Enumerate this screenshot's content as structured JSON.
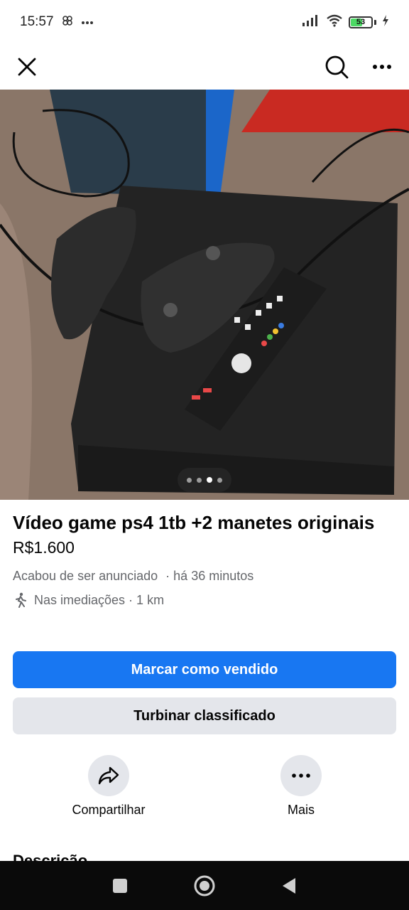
{
  "status_bar": {
    "time": "15:57",
    "battery": "53"
  },
  "listing": {
    "title": "Vídeo game ps4 1tb +2 manetes originais",
    "price": "R$1.600",
    "listed": "Acabou de ser anunciado",
    "listed_time": "· há 36 minutos",
    "location": "Nas imediações · 1 km",
    "photo_count": 4,
    "photo_index": 3
  },
  "buttons": {
    "mark_sold": "Marcar como vendido",
    "boost": "Turbinar classificado"
  },
  "actions": {
    "share": "Compartilhar",
    "more": "Mais"
  },
  "section_peek": "Descrição",
  "icons": [
    "close-icon",
    "search-icon",
    "more-horizontal-icon",
    "share-icon",
    "walking-icon",
    "wifi-icon",
    "signal-icon",
    "battery-icon"
  ],
  "colors": {
    "primary": "#1877f2",
    "secondary_bg": "#e4e6eb",
    "meta_text": "#65676b"
  }
}
